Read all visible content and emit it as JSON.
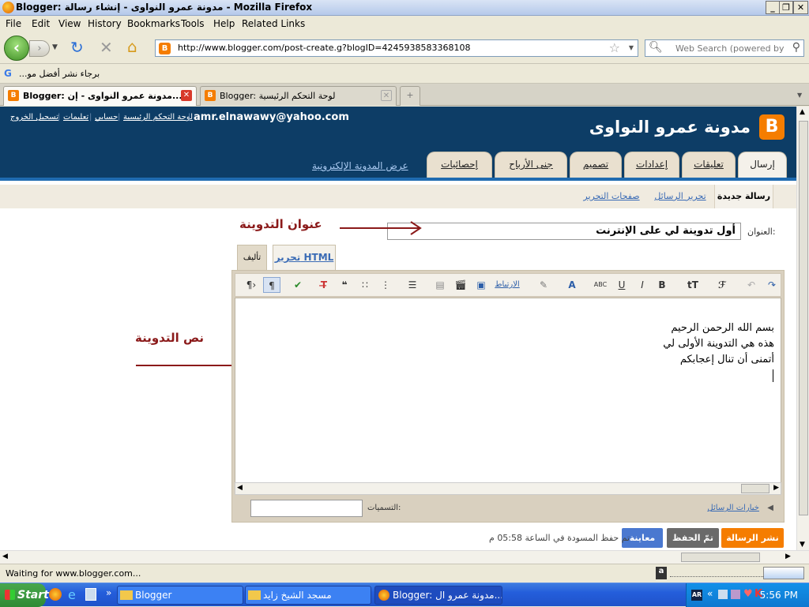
{
  "window": {
    "title": "Blogger: مدونة عمرو النواوى - إنشاء رسالة - Mozilla Firefox"
  },
  "menu": [
    "File",
    "Edit",
    "View",
    "History",
    "Bookmarks",
    "Tools",
    "Help",
    "Related Links"
  ],
  "nav": {
    "url": "http://www.blogger.com/post-create.g?blogID=4245938583368108",
    "search_placeholder": "Web Search (powered by Goo"
  },
  "bookmarks": {
    "item": "برجاء نشر أفضل مو..."
  },
  "tabs": [
    {
      "label": "Blogger: مدونة عمرو النواوى - إن..."
    },
    {
      "label": "Blogger: لوحة التحكم الرئيسية"
    }
  ],
  "blog": {
    "title": "مدونة عمرو النواوى",
    "email": "amr.elnawawy@yahoo.com",
    "header_links": [
      "لوحة التحكم الرئيسية",
      "حسابي",
      "تعليمات",
      "تسجيل الخروج"
    ],
    "view_blog": "عرض المدونة الإلكترونية",
    "tabs": [
      "إرسال",
      "تعليقات",
      "إعدادات",
      "تصميم",
      "جنى الأرباح",
      "إحصائيات"
    ],
    "subnav": [
      "رسالة جديدة",
      "تحرير الرسائل",
      "صفحات التحرير"
    ]
  },
  "editor": {
    "title_label": "العنوان:",
    "title_value": "أول تدوينة لي على الإنترنت",
    "annot_title": "عنوان التدوينة",
    "annot_body": "نص التدوينة",
    "tab_compose": "تأليف",
    "tab_html": "تحرير HTML",
    "link_btn": "الارتباط",
    "body_lines": [
      "بسم الله الرحمن الرحيم",
      "هذه هي التدوينة الأولى لي",
      "أتمنى أن تنال إعجابكم"
    ],
    "labels_label": "التسميات:",
    "post_options": "خيارات الرسائل"
  },
  "actions": {
    "publish": "نشر الرسالة",
    "saved": "تمّ الحفظ",
    "preview": "معاينة",
    "status": "تم حفظ المسودة في الساعة 05:58 م"
  },
  "statusbar": {
    "text": "Waiting for www.blogger.com..."
  },
  "taskbar": {
    "start": "Start",
    "tasks": [
      "Blogger",
      "مسجد الشيخ زايد",
      "Blogger: مدونة عمرو ال..."
    ],
    "clock": "5:56 PM"
  },
  "colors": {
    "header": "#0d3d66",
    "publish": "#f57d00",
    "preview": "#4a78d0",
    "saved": "#6a6a6a",
    "annotation": "#8b1a1a"
  }
}
